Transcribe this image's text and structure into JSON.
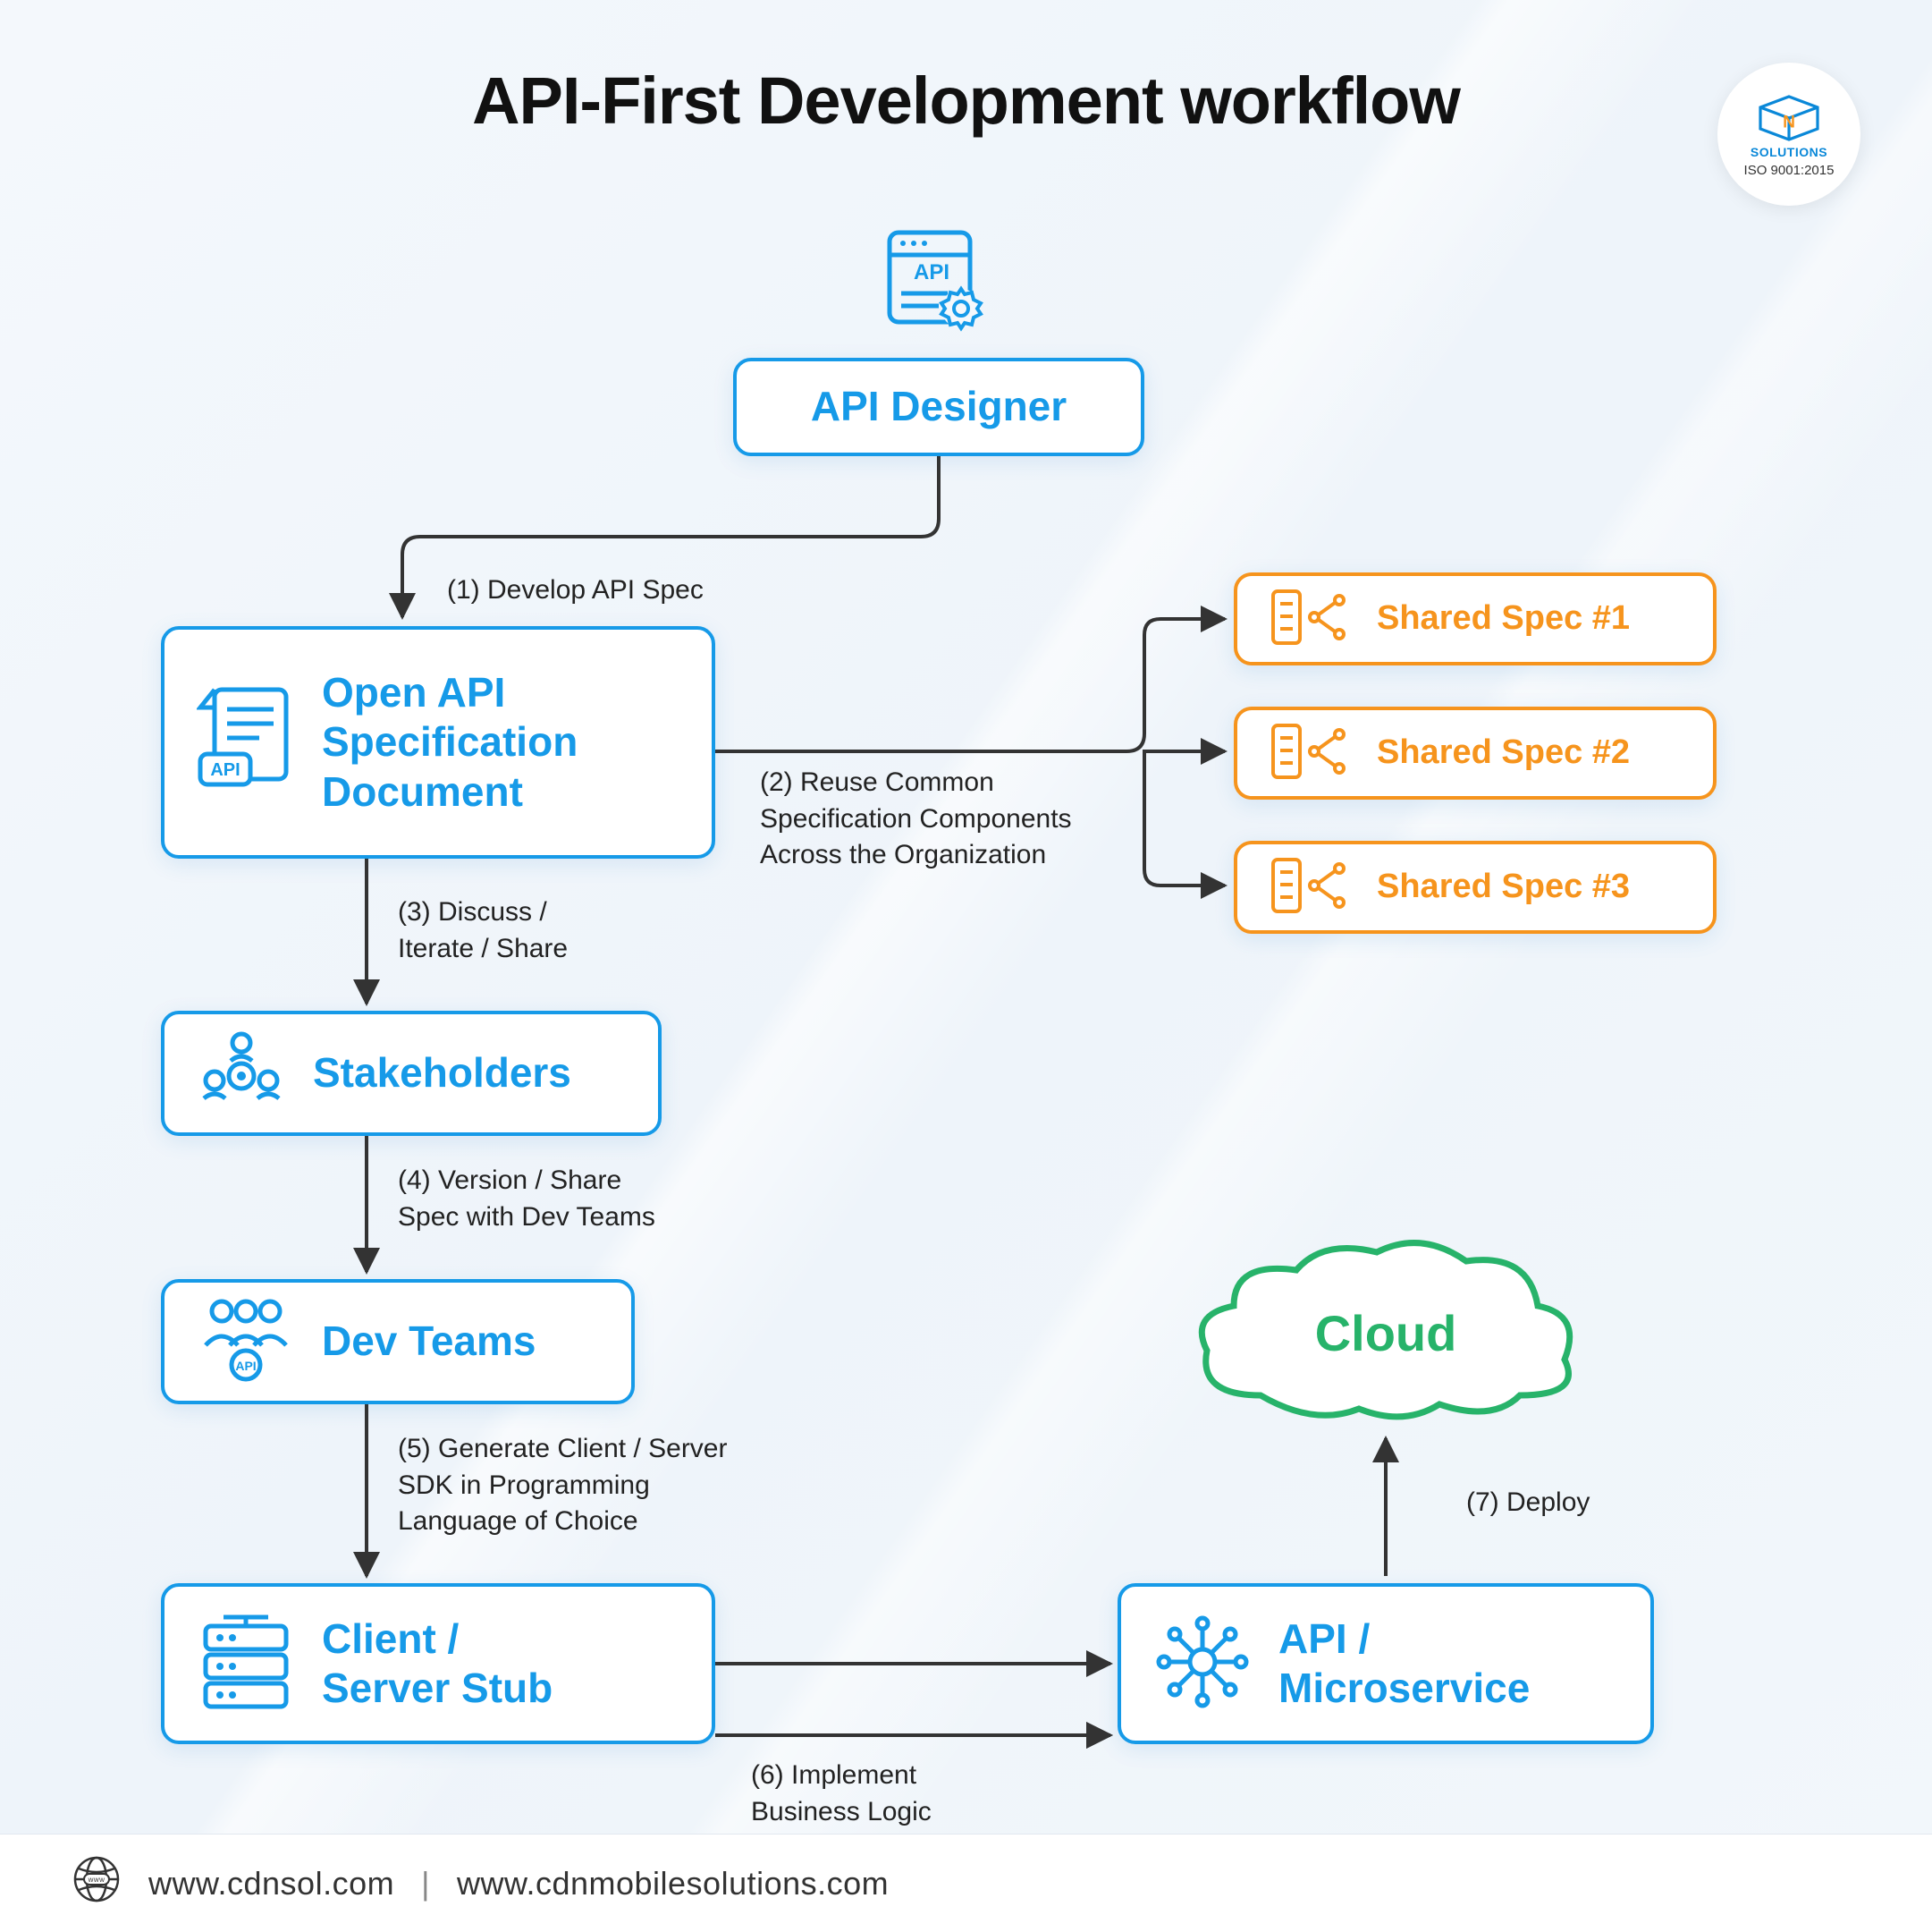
{
  "title": "API-First Development workflow",
  "logo": {
    "brand": "CDN",
    "sub": "SOLUTIONS",
    "iso": "ISO 9001:2015"
  },
  "nodes": {
    "api_designer": "API Designer",
    "open_api_spec": "Open API\nSpecification\nDocument",
    "stakeholders": "Stakeholders",
    "dev_teams": "Dev Teams",
    "client_server_stub": "Client /\nServer Stub",
    "api_microservice": "API /\nMicroservice",
    "cloud": "Cloud",
    "shared_spec_1": "Shared Spec #1",
    "shared_spec_2": "Shared Spec #2",
    "shared_spec_3": "Shared Spec #3"
  },
  "steps": {
    "s1": "(1) Develop API Spec",
    "s2": "(2) Reuse Common\nSpecification Components\nAcross the Organization",
    "s3": "(3) Discuss /\nIterate / Share",
    "s4": "(4) Version / Share\nSpec with Dev Teams",
    "s5": "(5) Generate Client / Server\nSDK in Programming\nLanguage of Choice",
    "s6": "(6) Implement\nBusiness Logic",
    "s7": "(7) Deploy"
  },
  "footer": {
    "url1": "www.cdnsol.com",
    "url2": "www.cdnmobilesolutions.com"
  },
  "colors": {
    "blue": "#169ae8",
    "orange": "#f6941d",
    "green": "#27b36a",
    "line": "#333"
  }
}
